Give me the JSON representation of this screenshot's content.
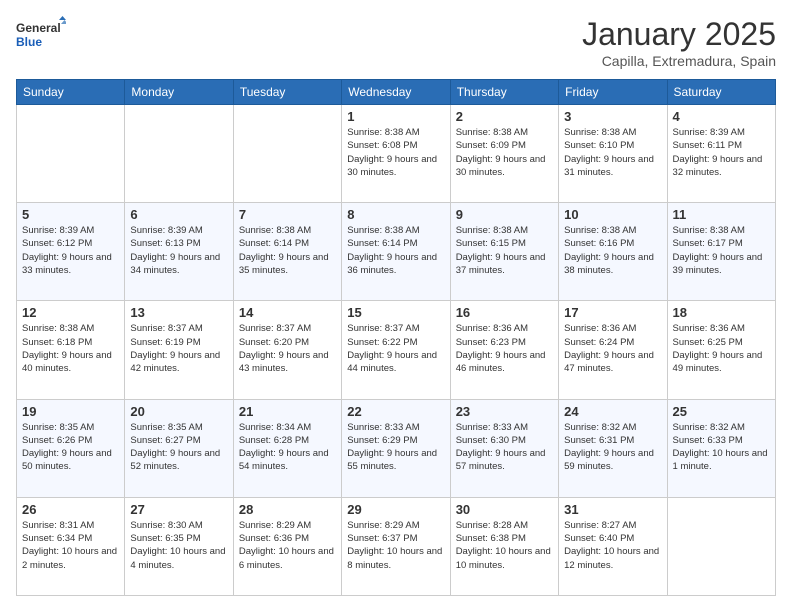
{
  "logo": {
    "general": "General",
    "blue": "Blue"
  },
  "header": {
    "month": "January 2025",
    "location": "Capilla, Extremadura, Spain"
  },
  "days_of_week": [
    "Sunday",
    "Monday",
    "Tuesday",
    "Wednesday",
    "Thursday",
    "Friday",
    "Saturday"
  ],
  "weeks": [
    [
      {
        "day": "",
        "content": ""
      },
      {
        "day": "",
        "content": ""
      },
      {
        "day": "",
        "content": ""
      },
      {
        "day": "1",
        "content": "Sunrise: 8:38 AM\nSunset: 6:08 PM\nDaylight: 9 hours and 30 minutes."
      },
      {
        "day": "2",
        "content": "Sunrise: 8:38 AM\nSunset: 6:09 PM\nDaylight: 9 hours and 30 minutes."
      },
      {
        "day": "3",
        "content": "Sunrise: 8:38 AM\nSunset: 6:10 PM\nDaylight: 9 hours and 31 minutes."
      },
      {
        "day": "4",
        "content": "Sunrise: 8:39 AM\nSunset: 6:11 PM\nDaylight: 9 hours and 32 minutes."
      }
    ],
    [
      {
        "day": "5",
        "content": "Sunrise: 8:39 AM\nSunset: 6:12 PM\nDaylight: 9 hours and 33 minutes."
      },
      {
        "day": "6",
        "content": "Sunrise: 8:39 AM\nSunset: 6:13 PM\nDaylight: 9 hours and 34 minutes."
      },
      {
        "day": "7",
        "content": "Sunrise: 8:38 AM\nSunset: 6:14 PM\nDaylight: 9 hours and 35 minutes."
      },
      {
        "day": "8",
        "content": "Sunrise: 8:38 AM\nSunset: 6:14 PM\nDaylight: 9 hours and 36 minutes."
      },
      {
        "day": "9",
        "content": "Sunrise: 8:38 AM\nSunset: 6:15 PM\nDaylight: 9 hours and 37 minutes."
      },
      {
        "day": "10",
        "content": "Sunrise: 8:38 AM\nSunset: 6:16 PM\nDaylight: 9 hours and 38 minutes."
      },
      {
        "day": "11",
        "content": "Sunrise: 8:38 AM\nSunset: 6:17 PM\nDaylight: 9 hours and 39 minutes."
      }
    ],
    [
      {
        "day": "12",
        "content": "Sunrise: 8:38 AM\nSunset: 6:18 PM\nDaylight: 9 hours and 40 minutes."
      },
      {
        "day": "13",
        "content": "Sunrise: 8:37 AM\nSunset: 6:19 PM\nDaylight: 9 hours and 42 minutes."
      },
      {
        "day": "14",
        "content": "Sunrise: 8:37 AM\nSunset: 6:20 PM\nDaylight: 9 hours and 43 minutes."
      },
      {
        "day": "15",
        "content": "Sunrise: 8:37 AM\nSunset: 6:22 PM\nDaylight: 9 hours and 44 minutes."
      },
      {
        "day": "16",
        "content": "Sunrise: 8:36 AM\nSunset: 6:23 PM\nDaylight: 9 hours and 46 minutes."
      },
      {
        "day": "17",
        "content": "Sunrise: 8:36 AM\nSunset: 6:24 PM\nDaylight: 9 hours and 47 minutes."
      },
      {
        "day": "18",
        "content": "Sunrise: 8:36 AM\nSunset: 6:25 PM\nDaylight: 9 hours and 49 minutes."
      }
    ],
    [
      {
        "day": "19",
        "content": "Sunrise: 8:35 AM\nSunset: 6:26 PM\nDaylight: 9 hours and 50 minutes."
      },
      {
        "day": "20",
        "content": "Sunrise: 8:35 AM\nSunset: 6:27 PM\nDaylight: 9 hours and 52 minutes."
      },
      {
        "day": "21",
        "content": "Sunrise: 8:34 AM\nSunset: 6:28 PM\nDaylight: 9 hours and 54 minutes."
      },
      {
        "day": "22",
        "content": "Sunrise: 8:33 AM\nSunset: 6:29 PM\nDaylight: 9 hours and 55 minutes."
      },
      {
        "day": "23",
        "content": "Sunrise: 8:33 AM\nSunset: 6:30 PM\nDaylight: 9 hours and 57 minutes."
      },
      {
        "day": "24",
        "content": "Sunrise: 8:32 AM\nSunset: 6:31 PM\nDaylight: 9 hours and 59 minutes."
      },
      {
        "day": "25",
        "content": "Sunrise: 8:32 AM\nSunset: 6:33 PM\nDaylight: 10 hours and 1 minute."
      }
    ],
    [
      {
        "day": "26",
        "content": "Sunrise: 8:31 AM\nSunset: 6:34 PM\nDaylight: 10 hours and 2 minutes."
      },
      {
        "day": "27",
        "content": "Sunrise: 8:30 AM\nSunset: 6:35 PM\nDaylight: 10 hours and 4 minutes."
      },
      {
        "day": "28",
        "content": "Sunrise: 8:29 AM\nSunset: 6:36 PM\nDaylight: 10 hours and 6 minutes."
      },
      {
        "day": "29",
        "content": "Sunrise: 8:29 AM\nSunset: 6:37 PM\nDaylight: 10 hours and 8 minutes."
      },
      {
        "day": "30",
        "content": "Sunrise: 8:28 AM\nSunset: 6:38 PM\nDaylight: 10 hours and 10 minutes."
      },
      {
        "day": "31",
        "content": "Sunrise: 8:27 AM\nSunset: 6:40 PM\nDaylight: 10 hours and 12 minutes."
      },
      {
        "day": "",
        "content": ""
      }
    ]
  ]
}
